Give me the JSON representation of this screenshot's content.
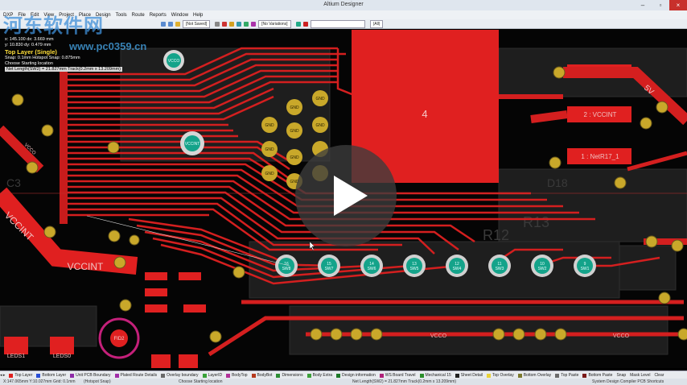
{
  "window": {
    "title": "Altium Designer",
    "minimize": "–",
    "maximize": "▫",
    "close": "×"
  },
  "watermark": {
    "brand": "河东软件网",
    "url": "www.pc0359.cn"
  },
  "menu": [
    "DXP",
    "File",
    "Edit",
    "View",
    "Project",
    "Place",
    "Design",
    "Tools",
    "Route",
    "Reports",
    "Window",
    "Help"
  ],
  "toolbar": {
    "saved_state": "[Not Saved]",
    "variations": "[No Variations]",
    "filter": "(All)"
  },
  "hud": {
    "coord_x": "x: 145.100   dx: 3.669 mm",
    "coord_y": "y: 10.830    dy: 0.479 mm",
    "layer": "Top Layer (Single)",
    "snap": "Snap: 0.1mm Hotspot Snap: 0.875mm",
    "action": "Choose Starting location",
    "net_length": "Net Length(SW2) = 21.827mm Track(0.2mm x 13.209mm)"
  },
  "pcb": {
    "big_pad_label": "4",
    "net_5v_pad": "3 : 5V",
    "net_5v_trace": "5V",
    "net_vccint_pad": "2 : VCCINT",
    "net_netr17_pad": "1 : NetR17_1",
    "vccint_trace_left": "VCCINT",
    "vccint_trace_mid": "VCCINT",
    "vcco_trace_a": "VCCO",
    "vcco_trace_b": "VCCO",
    "vcco_trace_left": "VCCO",
    "vcco_pad_top": "VCCO",
    "vccint_pad": "VCCINT",
    "gnd": "GND",
    "silk_leds1": "LEDS1",
    "silk_leds0": "LEDS0",
    "fid": "FID2",
    "silk_r12": "R12",
    "silk_r13": "R13",
    "silk_d18": "D18",
    "silk_c3": "C3",
    "sw_pads": [
      "SW8",
      "SW7",
      "SW6",
      "SW5",
      "SW4",
      "SW3",
      "SW2",
      "SW1"
    ],
    "sw_numbers": [
      "16",
      "15",
      "14",
      "13",
      "12",
      "11",
      "10",
      "9"
    ],
    "colors": {
      "top_layer": "#e02020",
      "pad_gold": "#c9a82a",
      "via_teal": "#14a38a",
      "board": "#050505",
      "silk_dark": "#2f2f2f"
    }
  },
  "layers": [
    {
      "name": "Top Layer",
      "color": "#e02020"
    },
    {
      "name": "Bottom Layer",
      "color": "#2a4fd6"
    },
    {
      "name": "Unit PCB Boundary",
      "color": "#8e2ca8"
    },
    {
      "name": "Plated Route Details",
      "color": "#a12ea8"
    },
    {
      "name": "Overlay boundary",
      "color": "#6a6a6a"
    },
    {
      "name": "LayerID",
      "color": "#39a23a"
    },
    {
      "name": "BodyTop",
      "color": "#b2329a"
    },
    {
      "name": "BodyBot",
      "color": "#b53a1f"
    },
    {
      "name": "Dimensions",
      "color": "#2e8e36"
    },
    {
      "name": "Body Extra",
      "color": "#3da03c"
    },
    {
      "name": "Design information",
      "color": "#1e7a2a"
    },
    {
      "name": "WS Board Travel",
      "color": "#b0227a"
    },
    {
      "name": "Mechanical 15",
      "color": "#2c8f2c"
    },
    {
      "name": "Sheet Detail",
      "color": "#222222"
    },
    {
      "name": "Top Overlay",
      "color": "#e8d23a"
    },
    {
      "name": "Bottom Overlay",
      "color": "#7c7a30"
    },
    {
      "name": "Top Paste",
      "color": "#6b6b6b"
    },
    {
      "name": "Bottom Paste",
      "color": "#7a1a1a"
    }
  ],
  "layer_tail": [
    "Snap",
    "Mask Level",
    "Clear"
  ],
  "status": {
    "coords": "X:147.065mm Y:10.027mm",
    "grid": "Grid: 0.1mm",
    "hotspot": "(Hotspot Snap)",
    "hint": "Choose Starting location",
    "net_length": "Net Length(SW2) = 21.827mm Track(0.2mm x 13.209mm)",
    "right": "System  Design Compiler  PCB  Shortcuts"
  },
  "video": {
    "state": "paused"
  }
}
